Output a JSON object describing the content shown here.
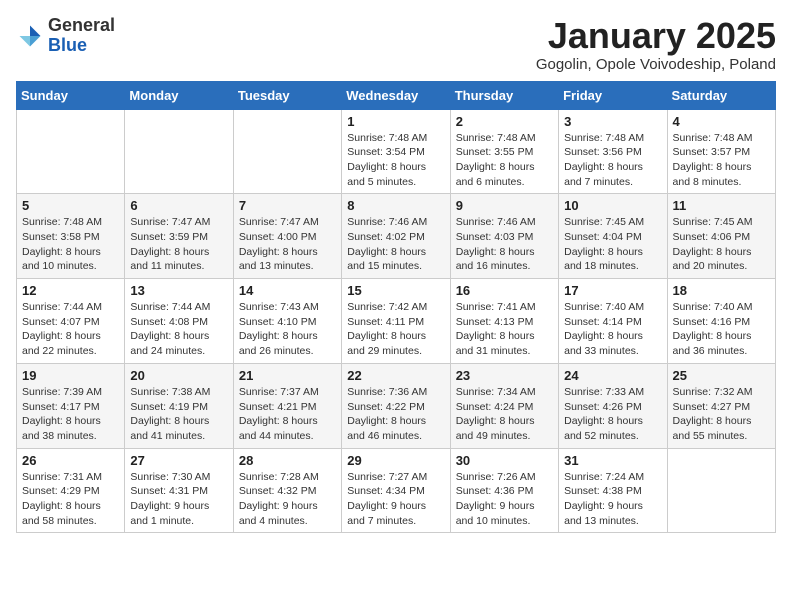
{
  "header": {
    "logo_general": "General",
    "logo_blue": "Blue",
    "month_title": "January 2025",
    "subtitle": "Gogolin, Opole Voivodeship, Poland"
  },
  "weekdays": [
    "Sunday",
    "Monday",
    "Tuesday",
    "Wednesday",
    "Thursday",
    "Friday",
    "Saturday"
  ],
  "weeks": [
    [
      {
        "day": "",
        "info": ""
      },
      {
        "day": "",
        "info": ""
      },
      {
        "day": "",
        "info": ""
      },
      {
        "day": "1",
        "info": "Sunrise: 7:48 AM\nSunset: 3:54 PM\nDaylight: 8 hours and 5 minutes."
      },
      {
        "day": "2",
        "info": "Sunrise: 7:48 AM\nSunset: 3:55 PM\nDaylight: 8 hours and 6 minutes."
      },
      {
        "day": "3",
        "info": "Sunrise: 7:48 AM\nSunset: 3:56 PM\nDaylight: 8 hours and 7 minutes."
      },
      {
        "day": "4",
        "info": "Sunrise: 7:48 AM\nSunset: 3:57 PM\nDaylight: 8 hours and 8 minutes."
      }
    ],
    [
      {
        "day": "5",
        "info": "Sunrise: 7:48 AM\nSunset: 3:58 PM\nDaylight: 8 hours and 10 minutes."
      },
      {
        "day": "6",
        "info": "Sunrise: 7:47 AM\nSunset: 3:59 PM\nDaylight: 8 hours and 11 minutes."
      },
      {
        "day": "7",
        "info": "Sunrise: 7:47 AM\nSunset: 4:00 PM\nDaylight: 8 hours and 13 minutes."
      },
      {
        "day": "8",
        "info": "Sunrise: 7:46 AM\nSunset: 4:02 PM\nDaylight: 8 hours and 15 minutes."
      },
      {
        "day": "9",
        "info": "Sunrise: 7:46 AM\nSunset: 4:03 PM\nDaylight: 8 hours and 16 minutes."
      },
      {
        "day": "10",
        "info": "Sunrise: 7:45 AM\nSunset: 4:04 PM\nDaylight: 8 hours and 18 minutes."
      },
      {
        "day": "11",
        "info": "Sunrise: 7:45 AM\nSunset: 4:06 PM\nDaylight: 8 hours and 20 minutes."
      }
    ],
    [
      {
        "day": "12",
        "info": "Sunrise: 7:44 AM\nSunset: 4:07 PM\nDaylight: 8 hours and 22 minutes."
      },
      {
        "day": "13",
        "info": "Sunrise: 7:44 AM\nSunset: 4:08 PM\nDaylight: 8 hours and 24 minutes."
      },
      {
        "day": "14",
        "info": "Sunrise: 7:43 AM\nSunset: 4:10 PM\nDaylight: 8 hours and 26 minutes."
      },
      {
        "day": "15",
        "info": "Sunrise: 7:42 AM\nSunset: 4:11 PM\nDaylight: 8 hours and 29 minutes."
      },
      {
        "day": "16",
        "info": "Sunrise: 7:41 AM\nSunset: 4:13 PM\nDaylight: 8 hours and 31 minutes."
      },
      {
        "day": "17",
        "info": "Sunrise: 7:40 AM\nSunset: 4:14 PM\nDaylight: 8 hours and 33 minutes."
      },
      {
        "day": "18",
        "info": "Sunrise: 7:40 AM\nSunset: 4:16 PM\nDaylight: 8 hours and 36 minutes."
      }
    ],
    [
      {
        "day": "19",
        "info": "Sunrise: 7:39 AM\nSunset: 4:17 PM\nDaylight: 8 hours and 38 minutes."
      },
      {
        "day": "20",
        "info": "Sunrise: 7:38 AM\nSunset: 4:19 PM\nDaylight: 8 hours and 41 minutes."
      },
      {
        "day": "21",
        "info": "Sunrise: 7:37 AM\nSunset: 4:21 PM\nDaylight: 8 hours and 44 minutes."
      },
      {
        "day": "22",
        "info": "Sunrise: 7:36 AM\nSunset: 4:22 PM\nDaylight: 8 hours and 46 minutes."
      },
      {
        "day": "23",
        "info": "Sunrise: 7:34 AM\nSunset: 4:24 PM\nDaylight: 8 hours and 49 minutes."
      },
      {
        "day": "24",
        "info": "Sunrise: 7:33 AM\nSunset: 4:26 PM\nDaylight: 8 hours and 52 minutes."
      },
      {
        "day": "25",
        "info": "Sunrise: 7:32 AM\nSunset: 4:27 PM\nDaylight: 8 hours and 55 minutes."
      }
    ],
    [
      {
        "day": "26",
        "info": "Sunrise: 7:31 AM\nSunset: 4:29 PM\nDaylight: 8 hours and 58 minutes."
      },
      {
        "day": "27",
        "info": "Sunrise: 7:30 AM\nSunset: 4:31 PM\nDaylight: 9 hours and 1 minute."
      },
      {
        "day": "28",
        "info": "Sunrise: 7:28 AM\nSunset: 4:32 PM\nDaylight: 9 hours and 4 minutes."
      },
      {
        "day": "29",
        "info": "Sunrise: 7:27 AM\nSunset: 4:34 PM\nDaylight: 9 hours and 7 minutes."
      },
      {
        "day": "30",
        "info": "Sunrise: 7:26 AM\nSunset: 4:36 PM\nDaylight: 9 hours and 10 minutes."
      },
      {
        "day": "31",
        "info": "Sunrise: 7:24 AM\nSunset: 4:38 PM\nDaylight: 9 hours and 13 minutes."
      },
      {
        "day": "",
        "info": ""
      }
    ]
  ]
}
